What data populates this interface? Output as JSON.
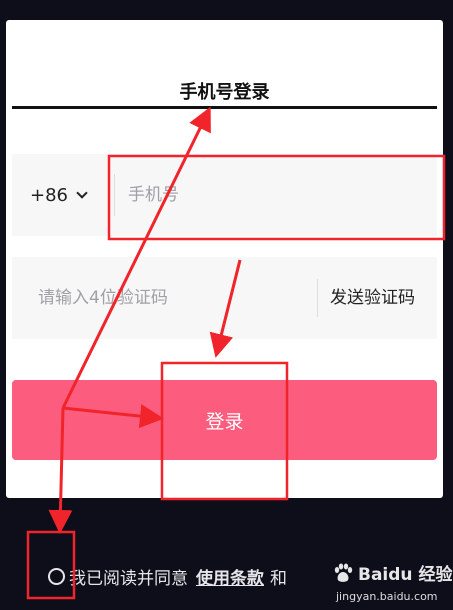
{
  "login": {
    "title": "手机号登录",
    "country_code": "+86",
    "phone_placeholder": "手机号",
    "code_placeholder": "请输入4位验证码",
    "send_code_label": "发送验证码",
    "login_button": "登录"
  },
  "agreement": {
    "text": "我已阅读并同意",
    "terms_link": "使用条款",
    "and_text": "和"
  },
  "watermark": {
    "brand": "Baidu 经验",
    "url": "jingyan.baidu.com"
  },
  "colors": {
    "accent": "#fc5c7d",
    "annotation": "#f0242a",
    "background": "#0e0e1a"
  }
}
